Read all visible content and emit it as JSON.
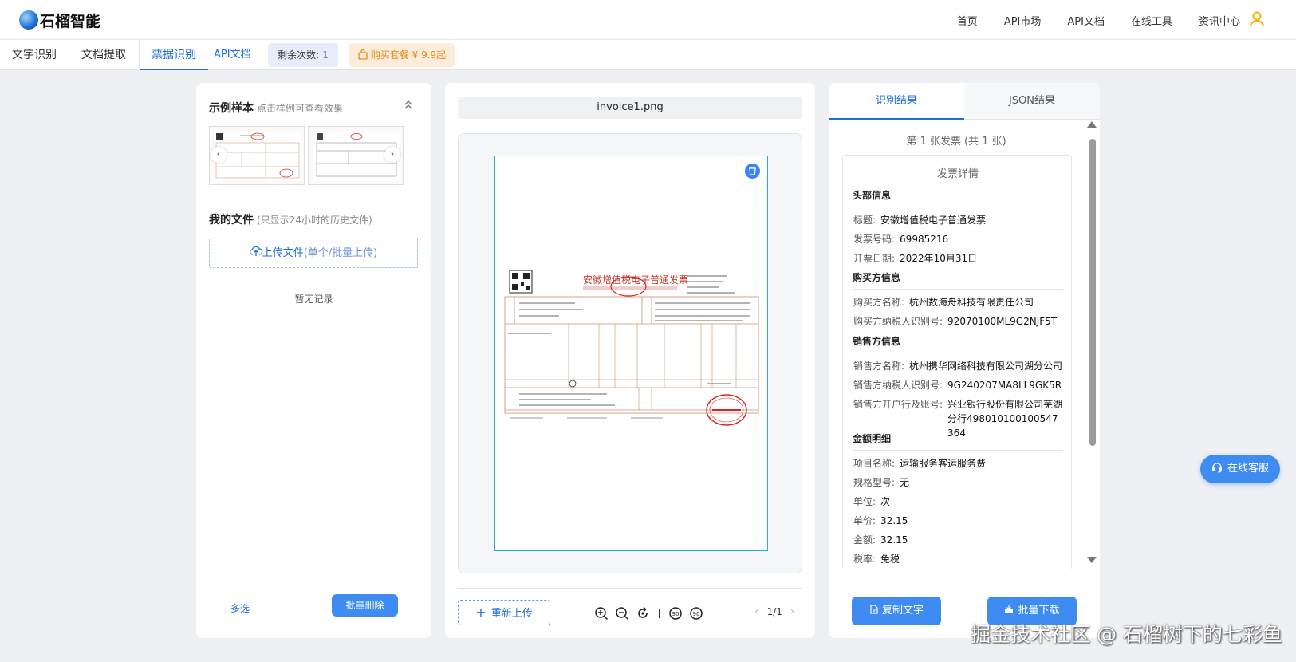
{
  "app": {
    "name": "石榴智能"
  },
  "topnav": {
    "items": [
      "首页",
      "API市场",
      "API文档",
      "在线工具",
      "资讯中心"
    ]
  },
  "subnav": {
    "tabs": [
      "文字识别",
      "文档提取",
      "票据识别"
    ],
    "active_tab": "票据识别",
    "api_doc": "API文档",
    "remain_label": "剩余次数:",
    "remain_value": "1",
    "buy_label": "购买套餐 ¥ 9.9起"
  },
  "left": {
    "samples_title": "示例样本",
    "samples_hint": "点击样例可查看效果",
    "files_title": "我的文件",
    "files_hint": "(只显示24小时的历史文件)",
    "upload_label": "上传文件",
    "upload_hint": "(单个/批量上传)",
    "empty_text": "暂无记录",
    "multi_select": "多选",
    "batch_delete": "批量删除"
  },
  "middle": {
    "filename": "invoice1.png",
    "reupload": "重新上传",
    "page": "1/1",
    "invoice_title": "安徽增值税电子普通发票"
  },
  "right": {
    "tabs": [
      "识别结果",
      "JSON结果"
    ],
    "active_tab": "识别结果",
    "invoice_count": "第 1 张发票 (共 1 张)",
    "detail_title": "发票详情",
    "groups": {
      "header": "头部信息",
      "buyer": "购买方信息",
      "seller": "销售方信息",
      "amount": "金额明细"
    },
    "fields": {
      "title": {
        "k": "标题:",
        "v": "安徽增值税电子普通发票"
      },
      "number": {
        "k": "发票号码:",
        "v": "69985216"
      },
      "date": {
        "k": "开票日期:",
        "v": "2022年10月31日"
      },
      "buyer_name": {
        "k": "购买方名称:",
        "v": "杭州数海舟科技有限责任公司"
      },
      "buyer_tax": {
        "k": "购买方纳税人识别号:",
        "v": "92070100ML9G2NJF5T"
      },
      "seller_name": {
        "k": "销售方名称:",
        "v": "杭州携华网络科技有限公司湖分公司"
      },
      "seller_tax": {
        "k": "销售方纳税人识别号:",
        "v": "9G240207MA8LL9GK5R"
      },
      "seller_bank": {
        "k": "销售方开户行及账号:",
        "v": "兴业银行股份有限公司芜湖分行498010100100547364"
      },
      "item_name": {
        "k": "项目名称:",
        "v": "运输服务客运服务费"
      },
      "spec": {
        "k": "规格型号:",
        "v": "无"
      },
      "unit": {
        "k": "单位:",
        "v": "次"
      },
      "price": {
        "k": "单价:",
        "v": "32.15"
      },
      "amount": {
        "k": "金额:",
        "v": "32.15"
      },
      "tax_rate": {
        "k": "税率:",
        "v": "免税"
      }
    },
    "copy_text": "复制文字",
    "batch_download": "批量下载"
  },
  "service": "在线客服",
  "watermark": "掘金技术社区 @ 石榴树下的七彩鱼",
  "colors": {
    "accent": "#3e8cf2",
    "link": "#1d6fd8",
    "buy_bg": "#fdecd9",
    "buy_text": "#e58a1c",
    "user_icon": "#f4b400",
    "invoice_red": "#c0392b"
  }
}
